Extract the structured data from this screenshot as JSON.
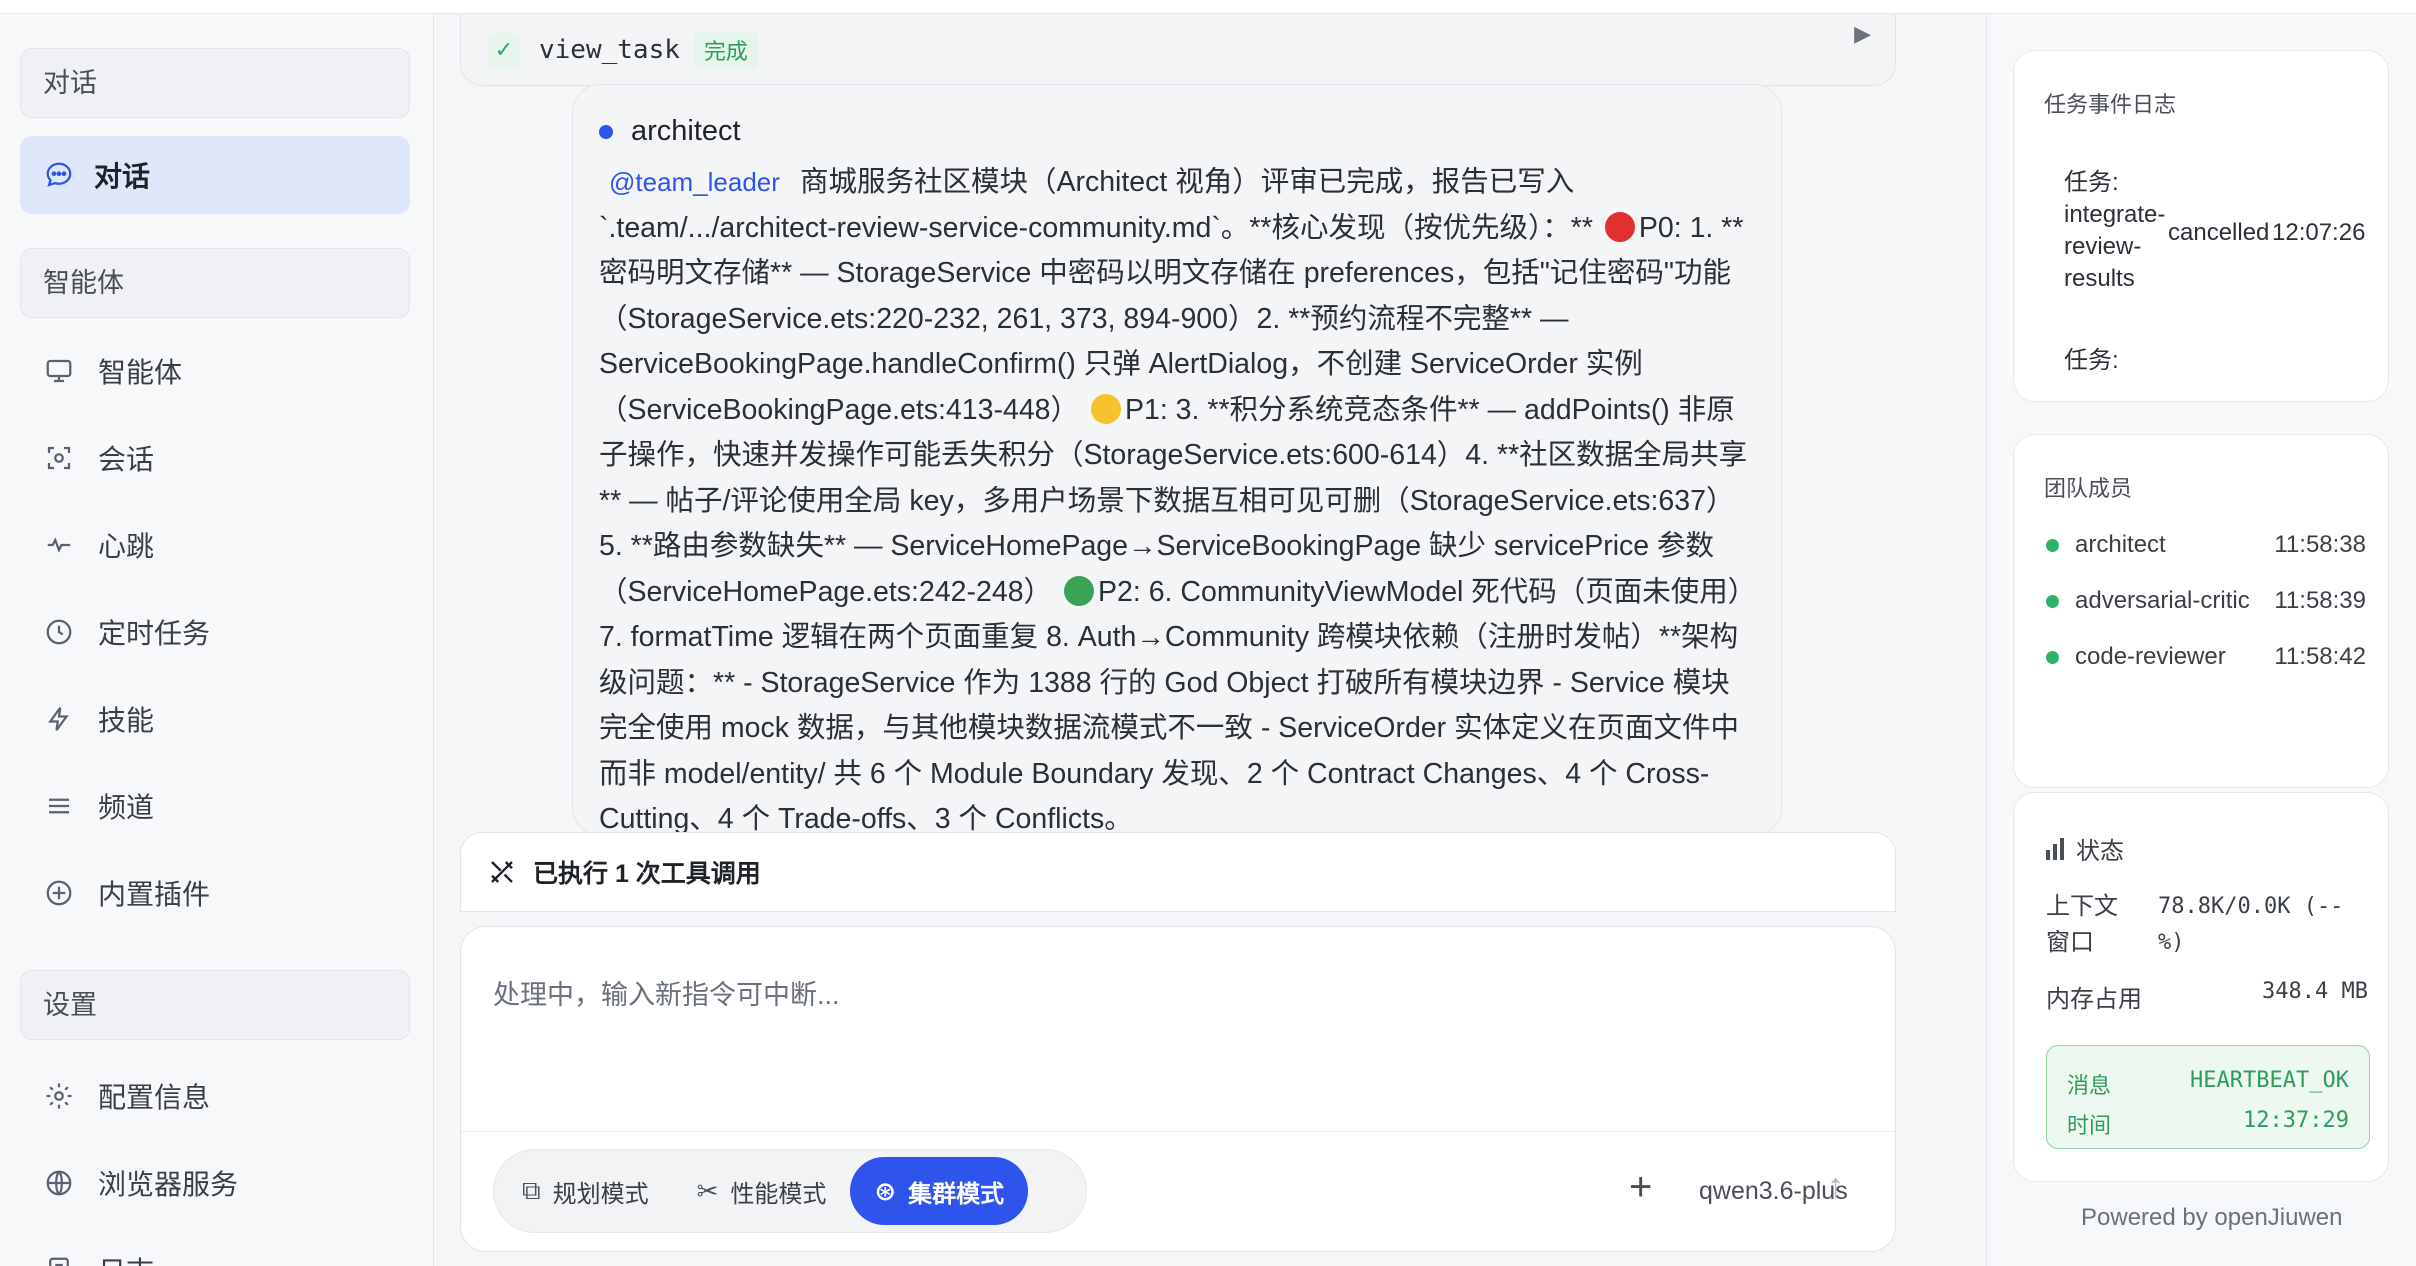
{
  "sidebar": {
    "sections": {
      "chat": "对话",
      "agents": "智能体",
      "settings": "设置"
    },
    "chat_item": "对话",
    "items": [
      {
        "label": "智能体",
        "icon": "monitor-icon"
      },
      {
        "label": "会话",
        "icon": "session-icon"
      },
      {
        "label": "心跳",
        "icon": "heartbeat-icon"
      },
      {
        "label": "定时任务",
        "icon": "clock-icon"
      },
      {
        "label": "技能",
        "icon": "lightning-icon"
      },
      {
        "label": "频道",
        "icon": "menu-icon"
      },
      {
        "label": "内置插件",
        "icon": "plus-circle-icon"
      }
    ],
    "settings_items": [
      {
        "label": "配置信息",
        "icon": "gear-icon"
      },
      {
        "label": "浏览器服务",
        "icon": "globe-icon"
      },
      {
        "label": "日志",
        "icon": "log-icon"
      }
    ]
  },
  "task": {
    "name": "view_task",
    "status": "完成"
  },
  "message": {
    "sender": "architect",
    "mention": "@team_leader",
    "p1": "商城服务社区模块（Architect 视角）评审已完成，报告已写入 `.team/.../architect-review-service-community.md`。**核心发现（按优先级）：**",
    "p0": "P0: 1. **密码明文存储** — StorageService 中密码以明文存储在 preferences，包括\"记住密码\"功能（StorageService.ets:220-232, 261, 373, 894-900）2. **预约流程不完整** — ServiceBookingPage.handleConfirm() 只弹 AlertDialog，不创建 ServiceOrder 实例（ServiceBookingPage.ets:413-448）",
    "p1_items": "P1: 3. **积分系统竞态条件** — addPoints() 非原子操作，快速并发操作可能丢失积分（StorageService.ets:600-614）4. **社区数据全局共享** — 帖子/评论使用全局 key，多用户场景下数据互相可见可删（StorageService.ets:637）5. **路由参数缺失** — ServiceHomePage→ServiceBookingPage 缺少 servicePrice 参数（ServiceHomePage.ets:242-248）",
    "p2_items": "P2: 6. CommunityViewModel 死代码（页面未使用）7. formatTime 逻辑在两个页面重复 8. Auth→Community 跨模块依赖（注册时发帖）**架构级问题：** - StorageService 作为 1388 行的 God Object 打破所有模块边界 - Service 模块完全使用 mock 数据，与其他模块数据流模式不一致 - ServiceOrder 实体定义在页面文件中而非 model/entity/ 共 6 个 Module Boundary 发现、2 个 Contract Changes、4 个 Cross-Cutting、4 个 Trade-offs、3 个 Conflicts。"
  },
  "tools_summary": "已执行 1 次工具调用",
  "composer": {
    "placeholder": "处理中，输入新指令可中断...",
    "modes": [
      "规划模式",
      "性能模式",
      "集群模式"
    ],
    "active_mode": "集群模式",
    "model": "qwen3.6-plus"
  },
  "events": {
    "title": "任务事件日志",
    "row1_label": "任务:",
    "row1_name": [
      "integrate-",
      "review-",
      "results"
    ],
    "row1_status": "cancelled",
    "row1_time": "12:07:26",
    "row2_label": "任务:"
  },
  "team": {
    "title": "团队成员",
    "members": [
      {
        "name": "architect",
        "time": "11:58:38"
      },
      {
        "name": "adversarial-critic",
        "time": "11:58:39"
      },
      {
        "name": "code-reviewer",
        "time": "11:58:42"
      }
    ]
  },
  "status": {
    "title": "状态",
    "context_label": "上下文窗口",
    "context_value": "78.8K/0.0K (--%)",
    "memory_label": "内存占用",
    "memory_value": "348.4 MB",
    "msg_label": "消息",
    "msg_value": "HEARTBEAT_OK",
    "time_label": "时间",
    "time_value": "12:37:29"
  },
  "footer": "Powered by openJiuwen",
  "colors": {
    "accent": "#2f54eb",
    "success": "#2fb36b",
    "p0_emoji": "#e03030",
    "p1_emoji": "#f5c32c",
    "p2_emoji": "#3aa356"
  }
}
